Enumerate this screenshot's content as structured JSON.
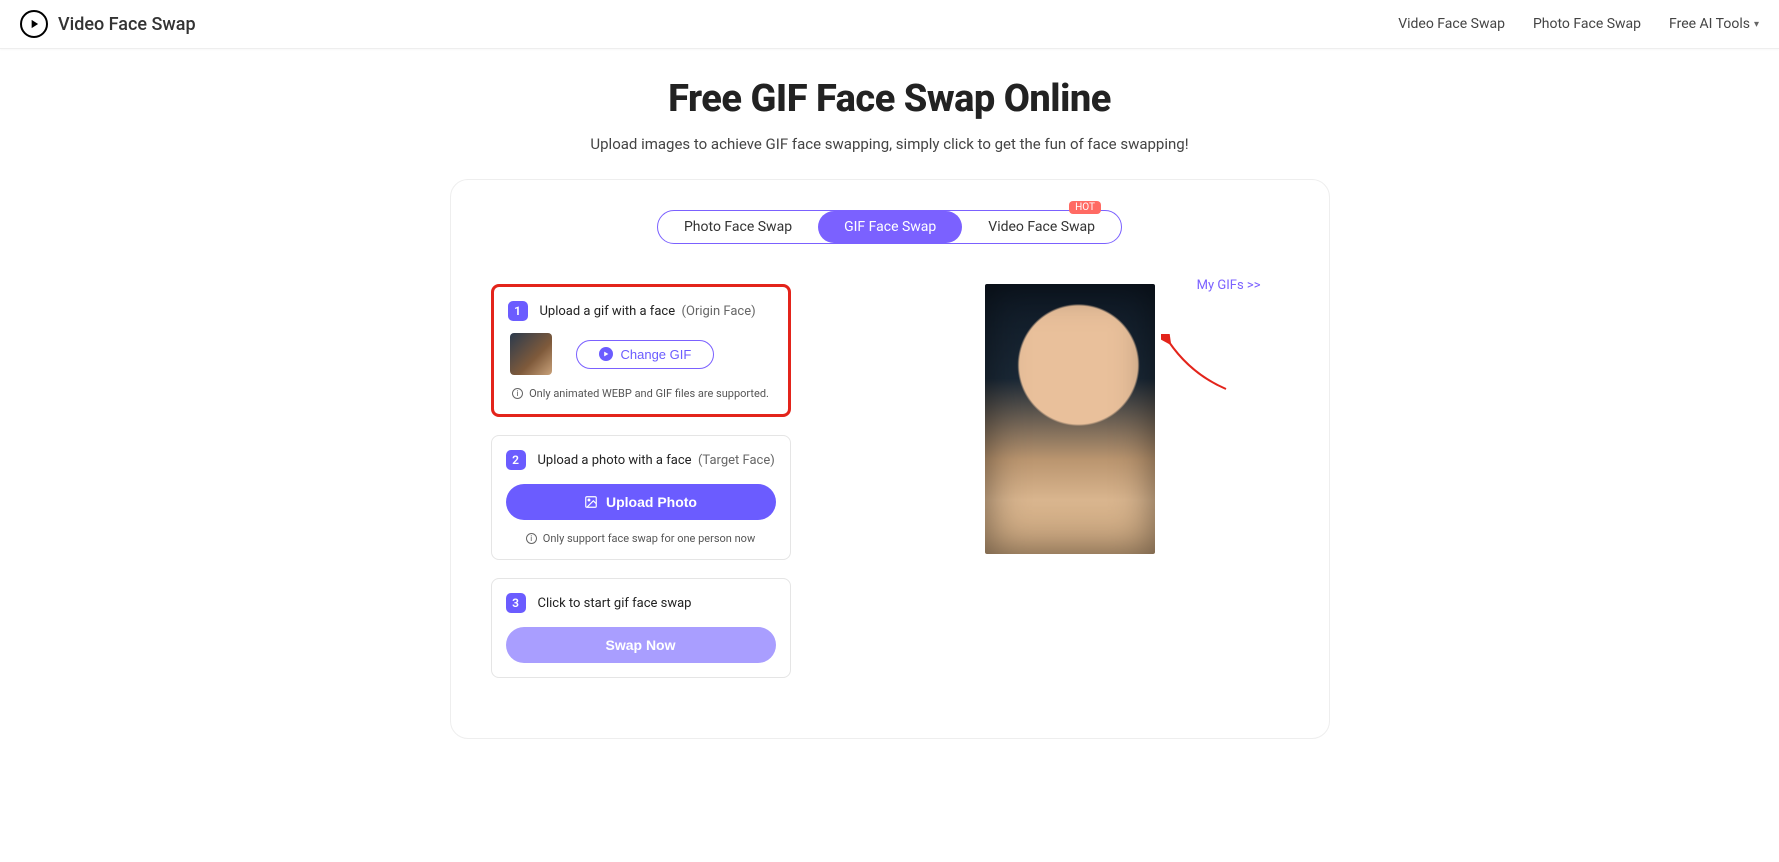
{
  "header": {
    "brand": "Video Face Swap",
    "nav": {
      "video": "Video Face Swap",
      "photo": "Photo Face Swap",
      "tools": "Free AI Tools"
    }
  },
  "hero": {
    "title": "Free GIF Face Swap Online",
    "subtitle": "Upload images to achieve GIF face swapping, simply click to get the fun of face swapping!"
  },
  "tabs": {
    "photo": "Photo Face Swap",
    "gif": "GIF Face Swap",
    "video": "Video Face Swap",
    "hot_badge": "HOT"
  },
  "mygifs": "My GIFs >>",
  "step1": {
    "num": "1",
    "label": "Upload a gif with a face",
    "hint": "(Origin Face)",
    "button": "Change GIF",
    "note": "Only animated WEBP and GIF files are supported."
  },
  "step2": {
    "num": "2",
    "label": "Upload a photo with a face",
    "hint": "(Target Face)",
    "button": "Upload Photo",
    "note": "Only support face swap for one person now"
  },
  "step3": {
    "num": "3",
    "label": "Click to start gif face swap",
    "button": "Swap Now"
  }
}
